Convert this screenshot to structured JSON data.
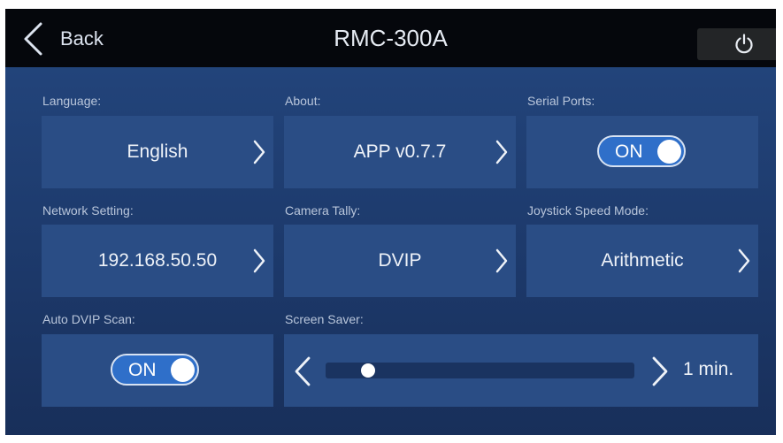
{
  "header": {
    "back_label": "Back",
    "title": "RMC-300A",
    "power_icon": "power-icon"
  },
  "settings": {
    "language": {
      "label": "Language:",
      "value": "English"
    },
    "about": {
      "label": "About:",
      "value": "APP v0.7.7"
    },
    "serial_ports": {
      "label": "Serial Ports:",
      "toggle": "ON"
    },
    "network": {
      "label": "Network Setting:",
      "value": "192.168.50.50"
    },
    "camera_tally": {
      "label": "Camera Tally:",
      "value": "DVIP"
    },
    "joystick_speed": {
      "label": "Joystick Speed Mode:",
      "value": "Arithmetic"
    },
    "auto_dvip": {
      "label": "Auto DVIP Scan:",
      "toggle": "ON"
    },
    "screen_saver": {
      "label": "Screen Saver:",
      "value": "1 min.",
      "slider_fraction": 0.12
    }
  },
  "colors": {
    "header_bg": "#05070c",
    "panel_bg": "#2a4d85",
    "toggle_on": "#2f6fc9"
  }
}
